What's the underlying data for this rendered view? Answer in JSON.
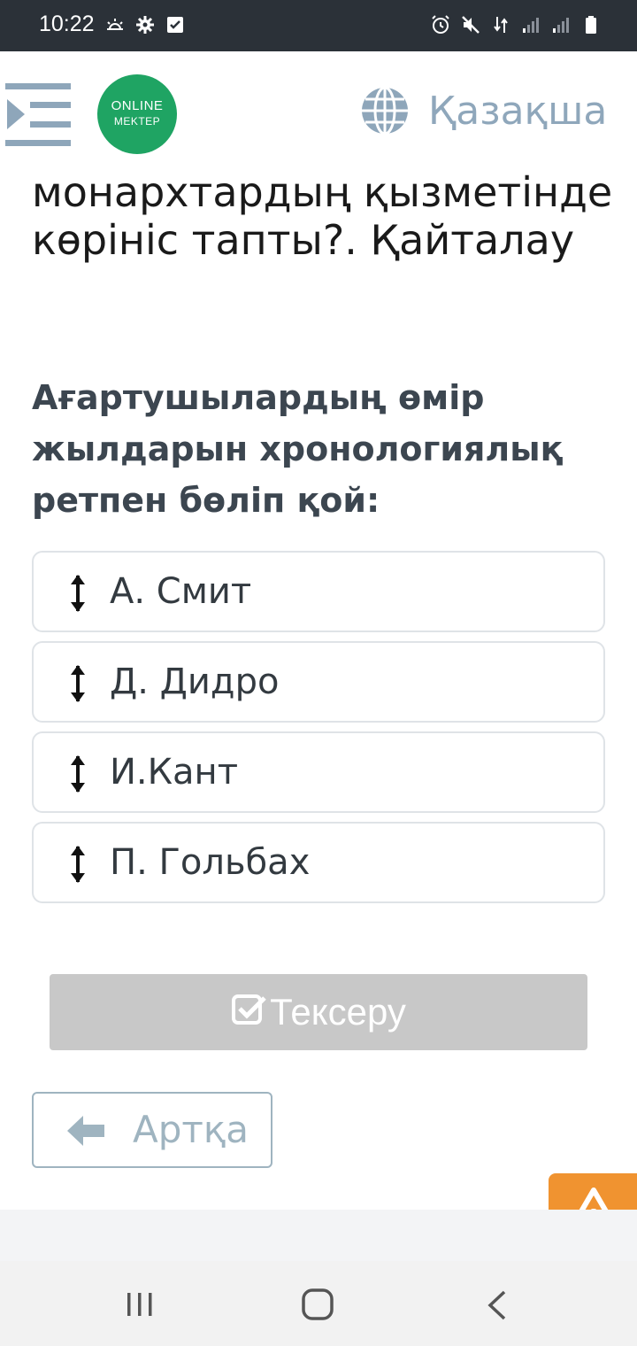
{
  "status_bar": {
    "time": "10:22",
    "left_icons": [
      "weather-icon",
      "gear-icon",
      "checkbox-notification-icon"
    ],
    "right_icons": [
      "alarm-icon",
      "mute-icon",
      "data-transfer-icon",
      "signal-icon",
      "signal-icon",
      "battery-icon"
    ]
  },
  "header": {
    "logo_line1": "ONLINE",
    "logo_line2": "MEKTEP",
    "language": "Қазақша",
    "colors": {
      "logo": "#1fa463",
      "language_text": "#8fa7bb"
    }
  },
  "question": {
    "title": "монархтардың қызметінде көрініс тапты?. Қайталау",
    "prompt": "Ағартушылардың өмір жылдарын хронологиялық ретпен бөліп қой:"
  },
  "options": [
    {
      "label": "А. Смит"
    },
    {
      "label": "Д. Дидро"
    },
    {
      "label": "И.Кант"
    },
    {
      "label": "П. Гольбах"
    }
  ],
  "actions": {
    "check_label": "Тексеру",
    "back_label": "Артқа",
    "colors": {
      "check_disabled": "#c8c8c8",
      "report": "#f09330"
    }
  }
}
